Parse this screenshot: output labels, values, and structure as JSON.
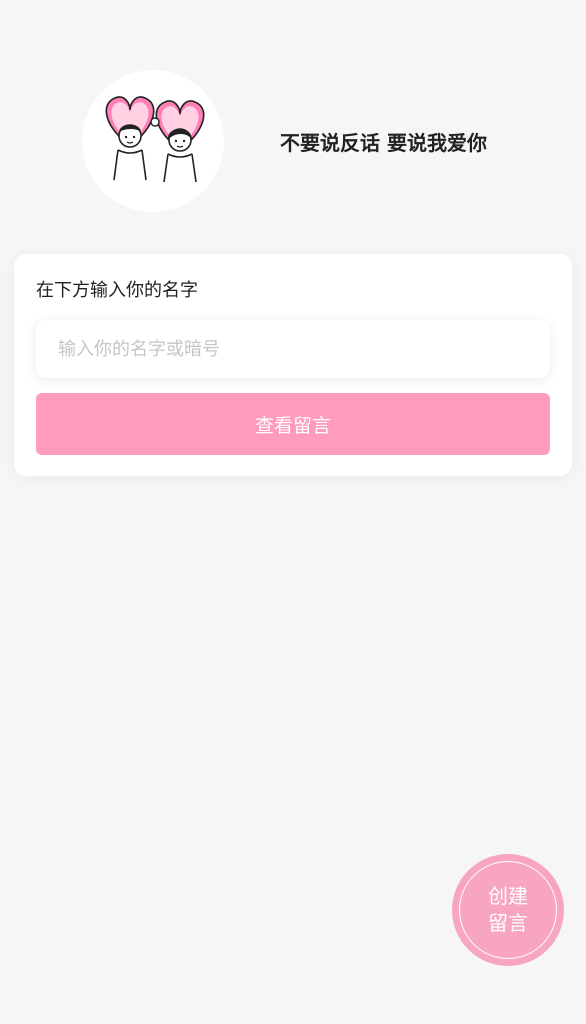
{
  "header": {
    "avatar_alt": "couple-hearts-illustration",
    "slogan": "不要说反话 要说我爱你"
  },
  "form": {
    "label": "在下方输入你的名字",
    "input_placeholder": "输入你的名字或暗号",
    "input_value": "",
    "submit_label": "查看留言"
  },
  "fab": {
    "line1": "创建",
    "line2": "留言"
  },
  "colors": {
    "background": "#f6f6f6",
    "primary_pink": "#ff9bbb",
    "fab_pink": "#f7a5c1",
    "heart_pink": "#ff7fb6"
  }
}
